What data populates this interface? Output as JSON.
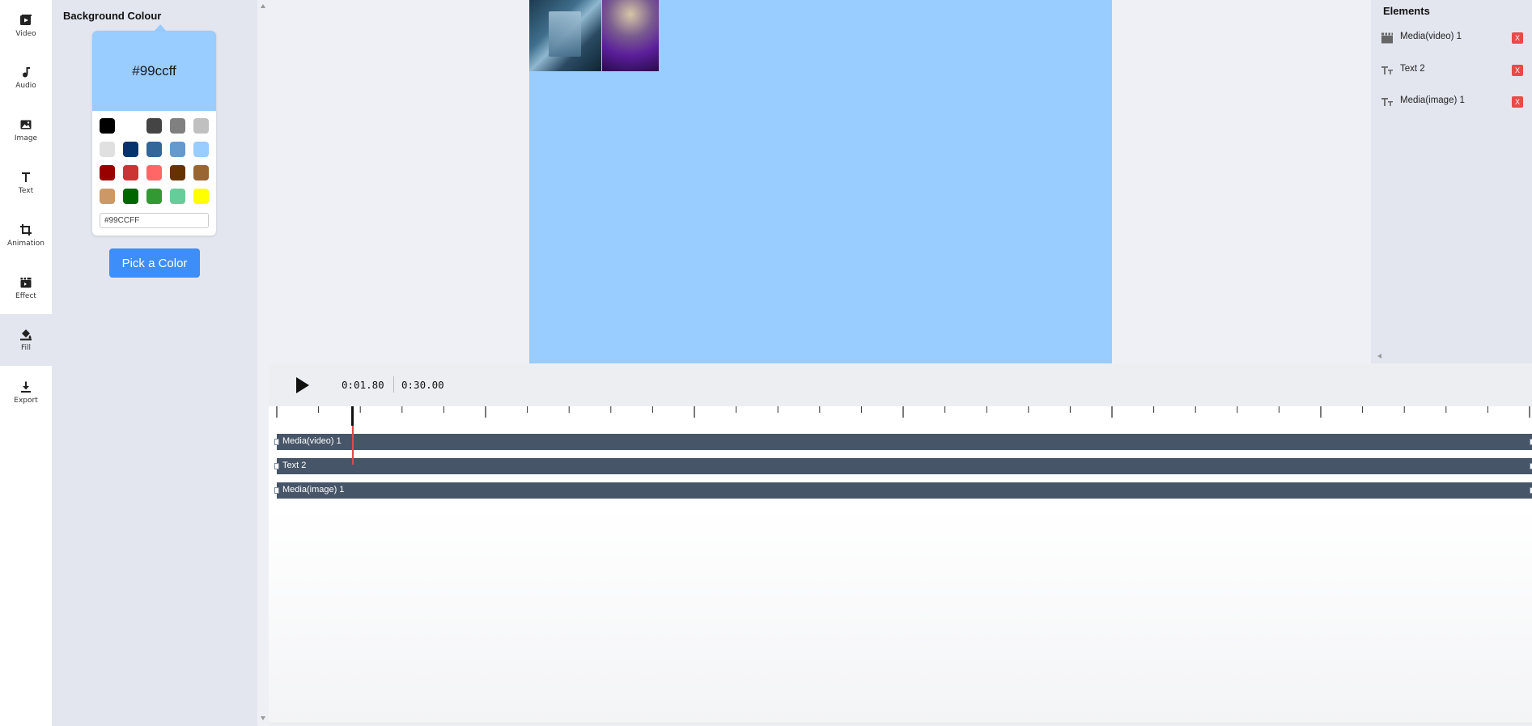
{
  "nav": {
    "items": [
      {
        "label": "Video",
        "icon": "video-icon"
      },
      {
        "label": "Audio",
        "icon": "music-note-icon"
      },
      {
        "label": "Image",
        "icon": "image-icon"
      },
      {
        "label": "Text",
        "icon": "text-icon"
      },
      {
        "label": "Animation",
        "icon": "crop-icon"
      },
      {
        "label": "Effect",
        "icon": "clapperboard-icon"
      },
      {
        "label": "Fill",
        "icon": "paint-bucket-icon"
      },
      {
        "label": "Export",
        "icon": "download-icon"
      }
    ],
    "active": "Fill"
  },
  "panel": {
    "title": "Background Colour",
    "preview_value": "#99ccff",
    "swatches": [
      "#000000",
      "#ffffff",
      "#444444",
      "#808080",
      "#c0c0c0",
      "#e0e0e0",
      "#06336b",
      "#336699",
      "#6699cc",
      "#99ccff",
      "#990000",
      "#cc3333",
      "#ff6666",
      "#663300",
      "#996633",
      "#cc9966",
      "#006600",
      "#339933",
      "#66cc99",
      "#ffff00"
    ],
    "hex_input": "#99CCFF",
    "pick_button": "Pick a Color"
  },
  "elements": {
    "title": "Elements",
    "items": [
      {
        "label": "Media(video) 1",
        "icon": "clapperboard-icon",
        "delete": "X"
      },
      {
        "label": "Text 2",
        "icon": "text-size-icon",
        "delete": "X"
      },
      {
        "label": "Media(image) 1",
        "icon": "text-size-icon",
        "delete": "X"
      }
    ]
  },
  "timeline": {
    "current_time": "0:01.80",
    "total_time": "0:30.00",
    "tracks": [
      {
        "label": "Media(video) 1"
      },
      {
        "label": "Text 2"
      },
      {
        "label": "Media(image) 1"
      }
    ]
  },
  "colors": {
    "accent": "#3d8ef8",
    "canvas_bg": "#99ccff",
    "track": "#475569",
    "delete": "#e84a4a",
    "playhead": "#e04a4a"
  }
}
